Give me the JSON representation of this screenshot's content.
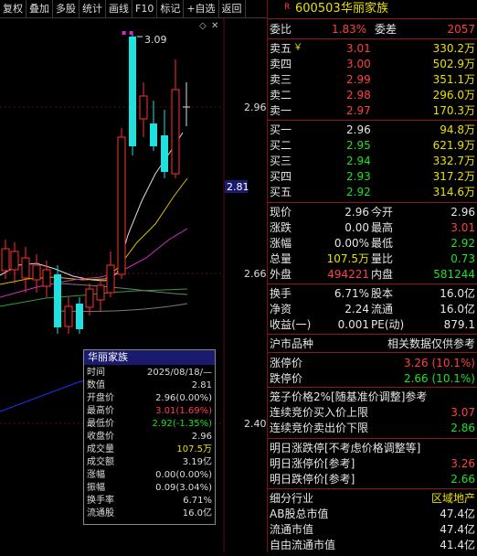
{
  "toolbar": {
    "items": [
      "复权",
      "叠加",
      "多股",
      "统计",
      "画线",
      "F10",
      "标记",
      "+自选",
      "返回"
    ]
  },
  "chart": {
    "price_labels": [
      "3.09",
      "2.96",
      "2.81",
      "2.66",
      "2.40"
    ],
    "popup": {
      "title": "华丽家族",
      "rows": [
        {
          "label": "时间",
          "value": "2025/08/18/—",
          "color": "#dddddd"
        },
        {
          "label": "数值",
          "value": "2.81",
          "color": "#dddddd"
        },
        {
          "label": "开盘价",
          "value": "2.96(0.00%)",
          "color": "#dddddd"
        },
        {
          "label": "最高价",
          "value": "3.01(1.69%)",
          "color": "#ff4040"
        },
        {
          "label": "最低价",
          "value": "2.92(-1.35%)",
          "color": "#20e020"
        },
        {
          "label": "收盘价",
          "value": "2.96",
          "color": "#dddddd"
        },
        {
          "label": "成交量",
          "value": "107.5万",
          "color": "#e8e000"
        },
        {
          "label": "成交额",
          "value": "3.19亿",
          "color": "#dddddd"
        },
        {
          "label": "涨幅",
          "value": "0.00(0.00%)",
          "color": "#dddddd"
        },
        {
          "label": "振幅",
          "value": "0.09(3.04%)",
          "color": "#dddddd"
        },
        {
          "label": "换手率",
          "value": "6.71%",
          "color": "#dddddd"
        },
        {
          "label": "流通股",
          "value": "16.0亿",
          "color": "#dddddd"
        }
      ]
    }
  },
  "quote": {
    "code": "600503",
    "name": "华丽家族",
    "r_mark": "R",
    "webi_label": "委比",
    "webi_value": "1.83%",
    "weicha_label": "委差",
    "weicha_value": "2057",
    "sells": [
      {
        "label": "卖五",
        "flag": "￥",
        "price": "3.01",
        "vol": "330.2万"
      },
      {
        "label": "卖四",
        "flag": "",
        "price": "3.00",
        "vol": "502.9万"
      },
      {
        "label": "卖三",
        "flag": "",
        "price": "2.99",
        "vol": "351.1万"
      },
      {
        "label": "卖二",
        "flag": "",
        "price": "2.98",
        "vol": "296.0万"
      },
      {
        "label": "卖一",
        "flag": "",
        "price": "2.97",
        "vol": "170.3万"
      }
    ],
    "buys": [
      {
        "label": "买一",
        "price": "2.96",
        "vol": "94.8万",
        "pcolor": "#e6e6e6"
      },
      {
        "label": "买二",
        "price": "2.95",
        "vol": "621.9万",
        "pcolor": "#20e020"
      },
      {
        "label": "买三",
        "price": "2.94",
        "vol": "332.7万",
        "pcolor": "#20e020"
      },
      {
        "label": "买四",
        "price": "2.93",
        "vol": "317.2万",
        "pcolor": "#20e020"
      },
      {
        "label": "买五",
        "price": "2.92",
        "vol": "314.6万",
        "pcolor": "#20e020"
      }
    ],
    "stats": [
      {
        "l1": "现价",
        "v1": "2.96",
        "c1": "#e6e6e6",
        "l2": "今开",
        "v2": "2.96",
        "c2": "#e6e6e6"
      },
      {
        "l1": "涨跌",
        "v1": "0.00",
        "c1": "#e6e6e6",
        "l2": "最高",
        "v2": "3.01",
        "c2": "#ff4040"
      },
      {
        "l1": "涨幅",
        "v1": "0.00%",
        "c1": "#e6e6e6",
        "l2": "最低",
        "v2": "2.92",
        "c2": "#20e020"
      },
      {
        "l1": "总量",
        "v1": "107.5万",
        "c1": "#e8e000",
        "l2": "量比",
        "v2": "0.73",
        "c2": "#20e020"
      },
      {
        "l1": "外盘",
        "v1": "494221",
        "c1": "#ff4040",
        "l2": "内盘",
        "v2": "581244",
        "c2": "#20e020"
      }
    ],
    "stats2": [
      {
        "l1": "换手",
        "v1": "6.71%",
        "l2": "股本",
        "v2": "16.0亿"
      },
      {
        "l1": "净资",
        "v1": "2.24",
        "l2": "流通",
        "v2": "16.0亿"
      },
      {
        "l1": "收益(一)",
        "v1": "0.001",
        "l2": "PE(动)",
        "v2": "879.1"
      }
    ],
    "market_label": "沪市品种",
    "related_label": "相关数据仅供参考",
    "limit_up_label": "涨停价",
    "limit_up_value": "3.26 (10.1%)",
    "limit_down_label": "跌停价",
    "limit_down_value": "2.66 (10.1%)",
    "cage_title": "笼子价格2%[随基准价调整]参考",
    "cage_buy_label": "连续竞价买入价上限",
    "cage_buy_value": "3.07",
    "cage_sell_label": "连续竞价卖出价下限",
    "cage_sell_value": "2.86",
    "tomorrow_title": "明日涨跌停[不考虑价格调整等]",
    "tomorrow_up_label": "明日涨停价[参考]",
    "tomorrow_up_value": "3.26",
    "tomorrow_down_label": "明日跌停价[参考]",
    "tomorrow_down_value": "2.66",
    "industry_label": "细分行业",
    "industry_value": "区域地产",
    "ab_label": "AB股总市值",
    "ab_value": "47.4亿",
    "float_label": "流通市值",
    "float_value": "47.4亿",
    "free_label": "自由流通市值",
    "free_value": "41.4亿"
  }
}
